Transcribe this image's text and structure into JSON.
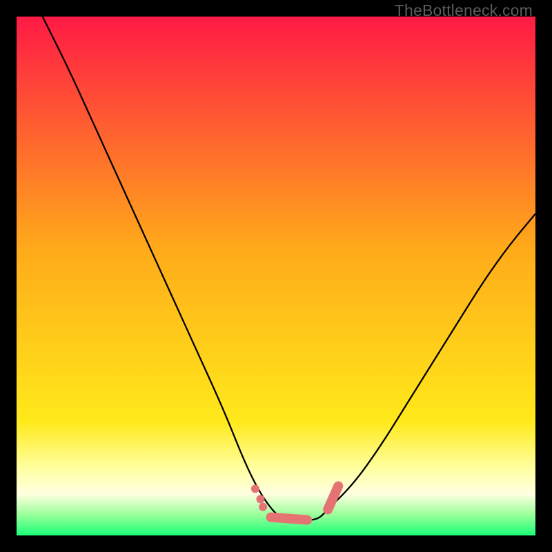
{
  "watermark": "TheBottleneck.com",
  "colors": {
    "gradient_top": "#ff1a45",
    "gradient_mid": "#ffc61a",
    "gradient_low": "#ffff66",
    "gradient_band": "#ffffb0",
    "gradient_bottom": "#1aff78",
    "curve": "#000000",
    "marker": "#e57373",
    "background": "#000000"
  },
  "chart_data": {
    "type": "line",
    "title": "",
    "xlabel": "",
    "ylabel": "",
    "xlim": [
      0,
      100
    ],
    "ylim": [
      0,
      100
    ],
    "series": [
      {
        "name": "bottleneck-curve",
        "x": [
          5,
          10,
          15,
          20,
          25,
          30,
          35,
          40,
          44,
          47,
          50,
          52,
          55,
          58,
          60,
          65,
          70,
          75,
          80,
          85,
          90,
          95,
          100
        ],
        "values": [
          100,
          90,
          79,
          68,
          57,
          46,
          35,
          24,
          14,
          8,
          4,
          3,
          3,
          3,
          5,
          10,
          17,
          25,
          33,
          41,
          49,
          56,
          62
        ]
      }
    ],
    "markers": {
      "name": "highlight-segments",
      "points": [
        {
          "x": 46,
          "y": 9
        },
        {
          "x": 47,
          "y": 7
        },
        {
          "x": 47.5,
          "y": 5.5
        },
        {
          "x": 49,
          "y": 3.5
        },
        {
          "x": 52,
          "y": 3
        },
        {
          "x": 54,
          "y": 3
        },
        {
          "x": 56,
          "y": 3
        },
        {
          "x": 60,
          "y": 5
        },
        {
          "x": 61,
          "y": 7
        },
        {
          "x": 62,
          "y": 9.5
        }
      ]
    },
    "gradient_stops": [
      {
        "offset": 0.0,
        "color": "#ff1a45"
      },
      {
        "offset": 0.45,
        "color": "#ffab1a"
      },
      {
        "offset": 0.78,
        "color": "#ffe91a"
      },
      {
        "offset": 0.87,
        "color": "#ffffa0"
      },
      {
        "offset": 0.92,
        "color": "#ffffe0"
      },
      {
        "offset": 0.96,
        "color": "#9aff9a"
      },
      {
        "offset": 1.0,
        "color": "#1aff78"
      }
    ]
  }
}
